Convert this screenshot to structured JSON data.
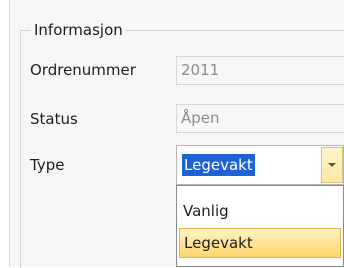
{
  "group": {
    "title": "Informasjon"
  },
  "fields": {
    "order_number": {
      "label": "Ordrenummer",
      "value": "2011"
    },
    "status": {
      "label": "Status",
      "value": "Åpen"
    },
    "type": {
      "label": "Type",
      "selected": "Legevakt",
      "options": [
        "Vanlig",
        "Legevakt"
      ],
      "highlighted_option": "Legevakt"
    }
  },
  "colors": {
    "selection_blue": "#1e63d6",
    "hover_gold": "#ffd66b"
  },
  "icons": {
    "dropdown": "chevron-down-icon"
  }
}
